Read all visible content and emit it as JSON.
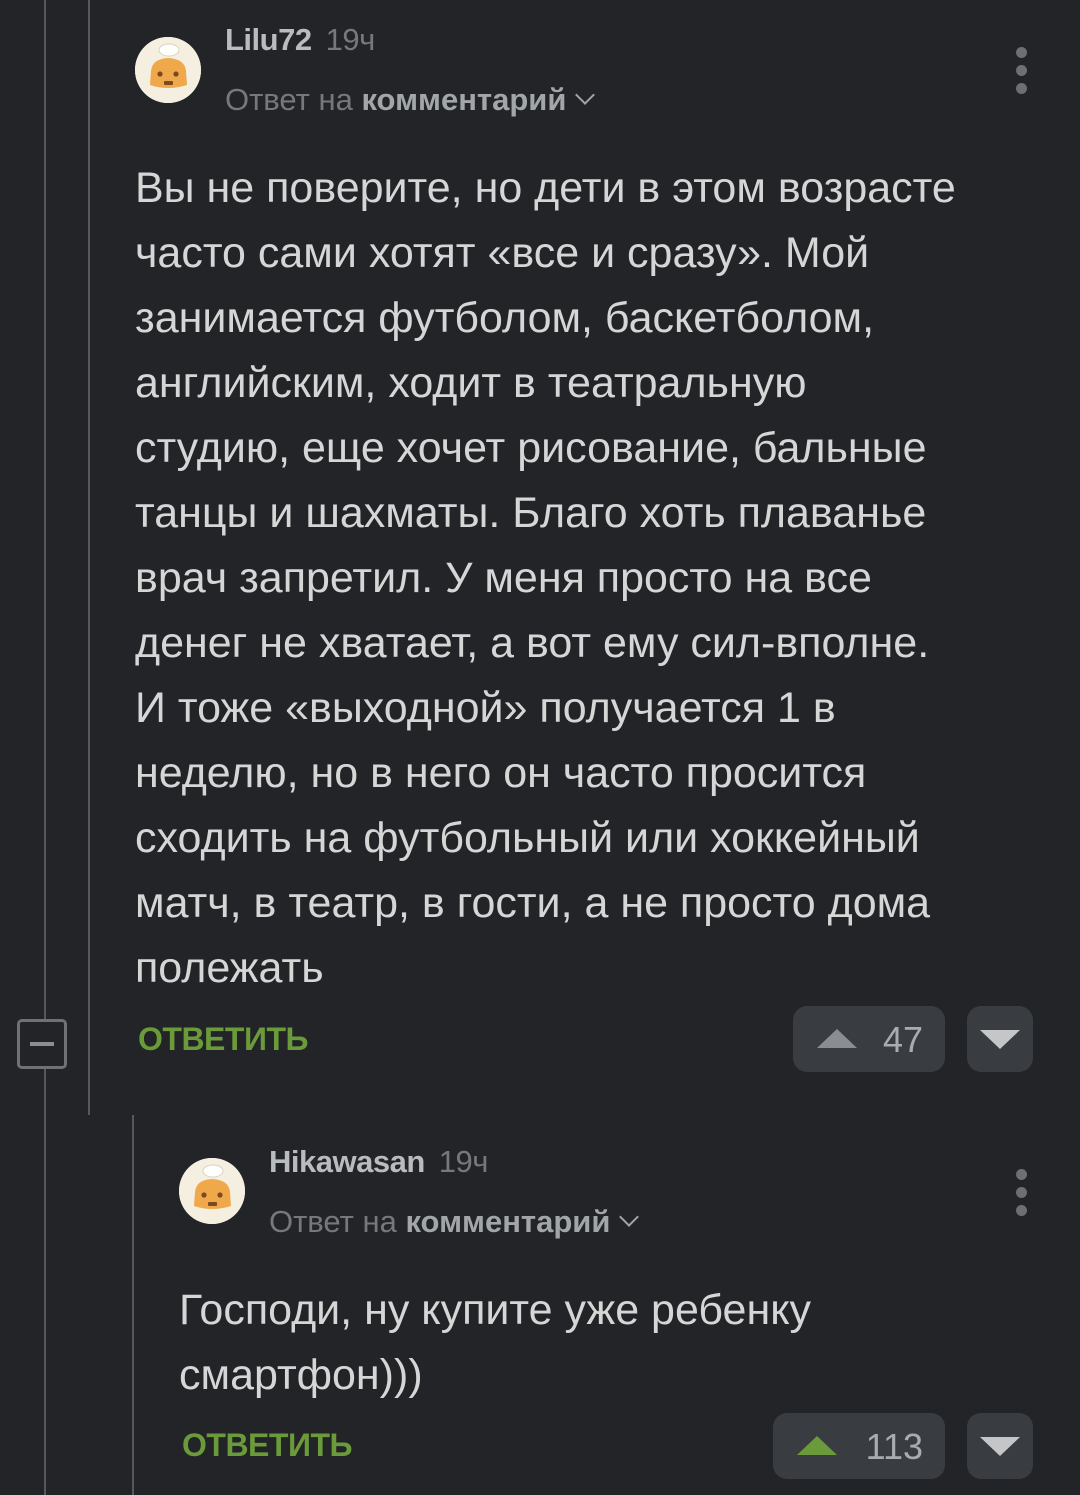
{
  "comments": [
    {
      "author": "Lilu72",
      "time": "19ч",
      "reply_prefix": "Ответ на",
      "reply_target": "комментарий",
      "text": "Вы не поверите, но дети в этом возрасте\nчасто сами хотят «все и сразу». Мой\nзанимается футболом, баскетболом,\nанглийским, ходит в театральную\nстудию, еще хочет рисование, бальные\nтанцы и шахматы. Благо хоть плаванье\nврач запретил. У меня просто на все\nденег не хватает, а вот ему сил-вполне.\nИ тоже «выходной» получается 1 в\nнеделю, но в него он часто просится\nсходить на футбольный или хоккейный\nматч, в театр, в гости, а не просто дома\nполежать",
      "reply_label": "ОТВЕТИТЬ",
      "votes": "47",
      "avatar_icon": "default-avatar-icon"
    },
    {
      "author": "Hikawasan",
      "time": "19ч",
      "reply_prefix": "Ответ на",
      "reply_target": "комментарий",
      "text": "Господи, ну купите уже ребенку\nсмартфон)))",
      "reply_label": "ОТВЕТИТЬ",
      "votes": "113",
      "avatar_icon": "default-avatar-icon"
    }
  ],
  "colors": {
    "background": "#222427",
    "reply_green": "#6b9a3a",
    "vote_button": "#393c40"
  }
}
